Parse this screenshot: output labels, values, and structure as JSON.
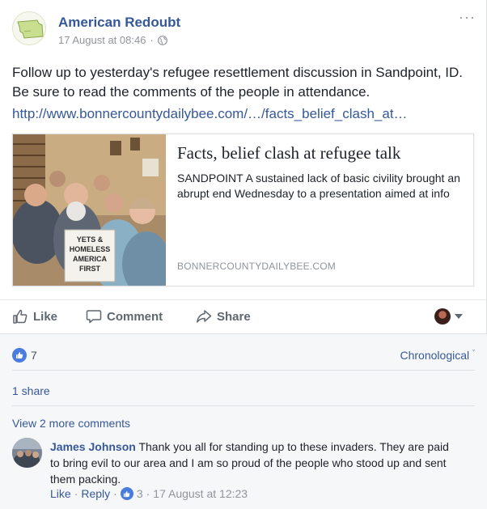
{
  "post": {
    "page_name": "American Redoubt",
    "timestamp": "17 August at 08:46",
    "meta_separator": "·",
    "more_menu": "···",
    "text": "Follow up to yesterday's refugee resettlement discussion in Sandpoint, ID. Be sure to read the comments of the people in attendance.",
    "link": "http://www.bonnercountydailybee.com/…/facts_belief_clash_at…"
  },
  "preview": {
    "title": "Facts, belief clash at refugee talk",
    "description": "SANDPOINT  A sustained lack of basic civility brought an abrupt end Wednesday to a presentation aimed at info",
    "domain": "BONNERCOUNTYDAILYBEE.COM",
    "sign_text": [
      "YETS &",
      "HOMELESS",
      "AMERICA",
      "FIRST"
    ]
  },
  "actions": {
    "like": "Like",
    "comment": "Comment",
    "share": "Share"
  },
  "feedback": {
    "reaction_count": "7",
    "order": "Chronological",
    "order_caret": "ˇ",
    "shares": "1 share",
    "view_more": "View 2 more comments"
  },
  "comment": {
    "author": "James Johnson",
    "text": "Thank you all for standing up to these invaders. They are paid to bring evil to our area and I am so proud of the people who stood up and sent them packing.",
    "like_label": "Like",
    "reply_label": "Reply",
    "separator": "·",
    "like_count": "3",
    "timestamp": "17 August at 12:23"
  },
  "colors": {
    "link_blue": "#365899",
    "secondary_grey": "#90949c",
    "reaction_blue": "#4a7bdf",
    "feedback_bg": "#f6f7f9"
  },
  "icons": {
    "avatar": "montana-map-logo",
    "privacy": "globe-icon",
    "like": "thumbs-up-icon",
    "comment": "speech-bubble-icon",
    "share": "share-arrow-icon",
    "audience": "profile-avatar"
  }
}
